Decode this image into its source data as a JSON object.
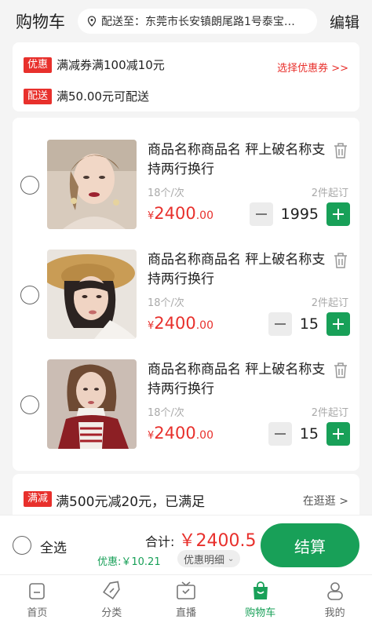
{
  "header": {
    "title": "购物车",
    "address": "配送至：东莞市长安镇朗尾路1号泰宝…",
    "edit": "编辑"
  },
  "promo": {
    "coupon_tag": "优惠",
    "coupon_text": "满减券满100减10元",
    "coupon_link": "选择优惠券 >>",
    "delivery_tag": "配送",
    "delivery_text": "满50.00元可配送"
  },
  "products": [
    {
      "name": "商品名称商品名 秤上破名称支持两行换行",
      "per": "18个/次",
      "min": "2件起订",
      "currency": "¥",
      "price_int": "2400",
      "price_dec": ".00",
      "qty": "1995"
    },
    {
      "name": "商品名称商品名 秤上破名称支持两行换行",
      "per": "18个/次",
      "min": "2件起订",
      "currency": "¥",
      "price_int": "2400",
      "price_dec": ".00",
      "qty": "15"
    },
    {
      "name": "商品名称商品名 秤上破名称支持两行换行",
      "per": "18个/次",
      "min": "2件起订",
      "currency": "¥",
      "price_int": "2400",
      "price_dec": ".00",
      "qty": "15"
    }
  ],
  "reduce": {
    "tag": "满减",
    "text": "满500元减20元，已满足",
    "link": "在逛逛 >"
  },
  "checkout": {
    "select_all": "全选",
    "total_label": "合计:",
    "total_amount": "￥2400.5",
    "discount": "优惠:￥10.21",
    "discount_detail": "优惠明细",
    "pay": "结算"
  },
  "tabs": [
    {
      "label": "首页",
      "icon": "home-icon"
    },
    {
      "label": "分类",
      "icon": "tag-icon"
    },
    {
      "label": "直播",
      "icon": "tv-icon"
    },
    {
      "label": "购物车",
      "icon": "bag-icon",
      "active": true
    },
    {
      "label": "我的",
      "icon": "user-icon"
    }
  ],
  "colors": {
    "accent": "#18a058",
    "price": "#e8302c"
  }
}
